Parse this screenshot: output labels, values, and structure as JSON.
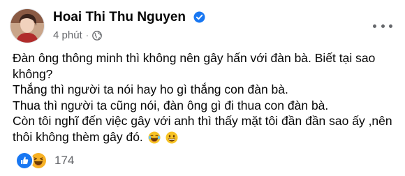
{
  "post": {
    "author": "Hoai Thi Thu Nguyen",
    "time": "4 phút",
    "separator": "·",
    "lines": [
      "Đàn ông thông minh thì không nên gây hấn với đàn bà. Biết tại sao không?",
      "Thắng thì người ta nói hay ho gì thắng con đàn bà.",
      "Thua thì người ta cũng nói, đàn ông gì đi thua con đàn bà.",
      "Còn tôi nghĩ đến việc gây với anh thì thấy mặt tôi đần đần sao ấy ,nên thôi không thèm gây đó."
    ],
    "reaction_count": "174"
  },
  "icons": [
    "verified-badge-icon",
    "globe-icon",
    "more-options-icon",
    "like-reaction-icon",
    "haha-reaction-icon",
    "laughing-emoji-icon",
    "grinning-emoji-icon"
  ],
  "colors": {
    "accent": "#1877f2",
    "secondary_text": "#65676b",
    "haha": "#f7b125"
  }
}
